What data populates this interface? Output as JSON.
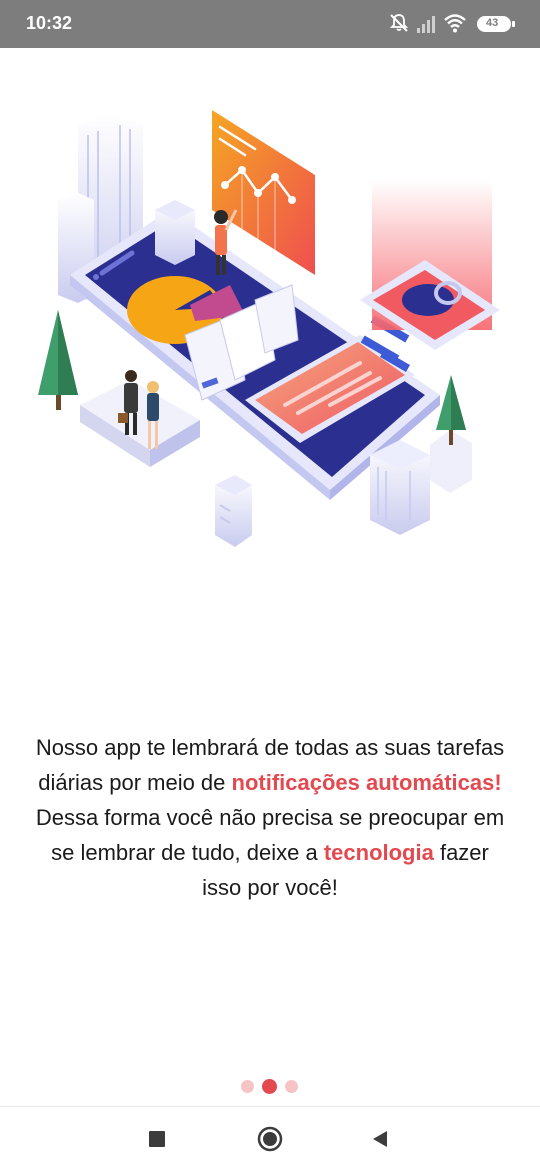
{
  "status_bar": {
    "time": "10:32",
    "battery_level": "43",
    "icons": [
      "mute-icon",
      "signal-icon",
      "wifi-icon",
      "battery-icon"
    ]
  },
  "illustration": {
    "icon": "smartphone-dashboard-illustration"
  },
  "onboarding": {
    "text_parts": [
      "Nosso app te lembrará de todas as suas tarefas diárias por meio de ",
      "notificações automáticas!",
      "  Dessa forma você não precisa se preocupar em se lembrar de tudo, deixe a ",
      "tecnologia",
      " fazer isso por você!"
    ],
    "highlight_color": "#e3494f",
    "current_page": 2,
    "total_pages": 3
  },
  "navigation": {
    "buttons": [
      "recents-square-icon",
      "home-circle-icon",
      "back-triangle-icon"
    ]
  }
}
